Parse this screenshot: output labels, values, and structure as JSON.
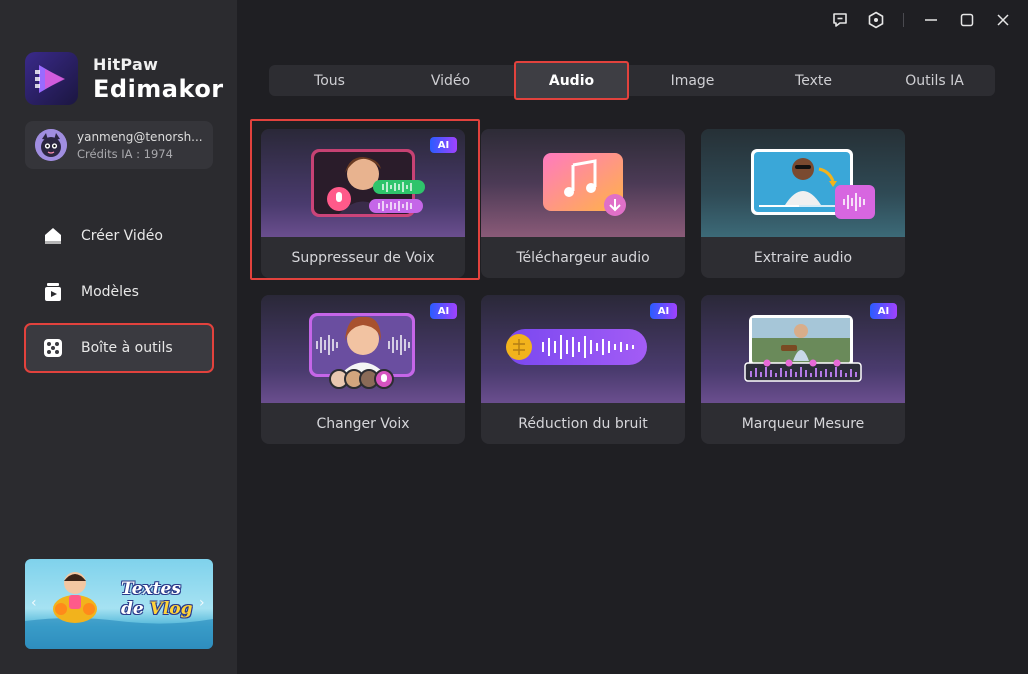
{
  "app": {
    "brand_line1": "HitPaw",
    "brand_line2": "Edimakor"
  },
  "user": {
    "email": "yanmeng@tenorsh...",
    "credits": "Crédits IA : 1974"
  },
  "sidebar": {
    "items": [
      {
        "label": "Créer Vidéo",
        "icon": "home-icon",
        "active": false
      },
      {
        "label": "Modèles",
        "icon": "templates-icon",
        "active": false
      },
      {
        "label": "Boîte à outils",
        "icon": "toolbox-icon",
        "active": true
      }
    ]
  },
  "promo": {
    "line1": "Textes",
    "line2_a": "de ",
    "line2_b": "Vlog"
  },
  "titlebar": {
    "icons": [
      "feedback-icon",
      "settings-icon",
      "minimize-icon",
      "maximize-icon",
      "close-icon"
    ]
  },
  "tabs": [
    {
      "label": "Tous",
      "active": false
    },
    {
      "label": "Vidéo",
      "active": false
    },
    {
      "label": "Audio",
      "active": true
    },
    {
      "label": "Image",
      "active": false
    },
    {
      "label": "Texte",
      "active": false
    },
    {
      "label": "Outils IA",
      "active": false
    }
  ],
  "cards": [
    {
      "label": "Suppresseur de Voix",
      "ai": true,
      "badge": "AI",
      "highlighted": true
    },
    {
      "label": "Téléchargeur audio",
      "ai": false,
      "highlighted": false
    },
    {
      "label": "Extraire audio",
      "ai": false,
      "highlighted": false
    },
    {
      "label": "Changer Voix",
      "ai": true,
      "badge": "AI",
      "highlighted": false
    },
    {
      "label": "Réduction du bruit",
      "ai": true,
      "badge": "AI",
      "highlighted": false
    },
    {
      "label": "Marqueur Mesure",
      "ai": true,
      "badge": "AI",
      "highlighted": false
    }
  ],
  "colors": {
    "accent_outline": "#e2423d",
    "background": "#1f1f23",
    "sidebar": "#2b2b2f",
    "ai_badge_start": "#2a5cff",
    "ai_badge_end": "#a142ff"
  }
}
